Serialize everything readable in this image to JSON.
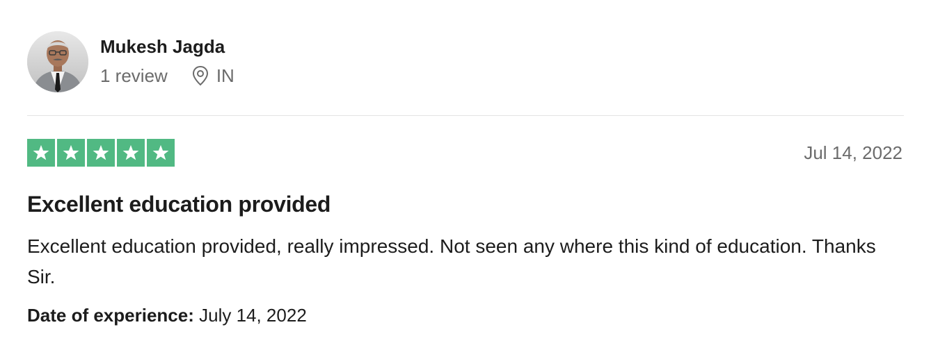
{
  "reviewer": {
    "name": "Mukesh Jagda",
    "review_count": "1 review",
    "location": "IN",
    "avatar_icon": "person-photo"
  },
  "review": {
    "rating": 5,
    "rating_max": 5,
    "rating_color": "#51b983",
    "date": "Jul 14, 2022",
    "title": "Excellent education provided",
    "body": "Excellent education provided, really impressed. Not seen any where this kind of education. Thanks Sir.",
    "experience_label": "Date of experience:",
    "experience_date": "July 14, 2022"
  },
  "icons": {
    "location": "location-pin-icon",
    "star": "star-icon"
  }
}
